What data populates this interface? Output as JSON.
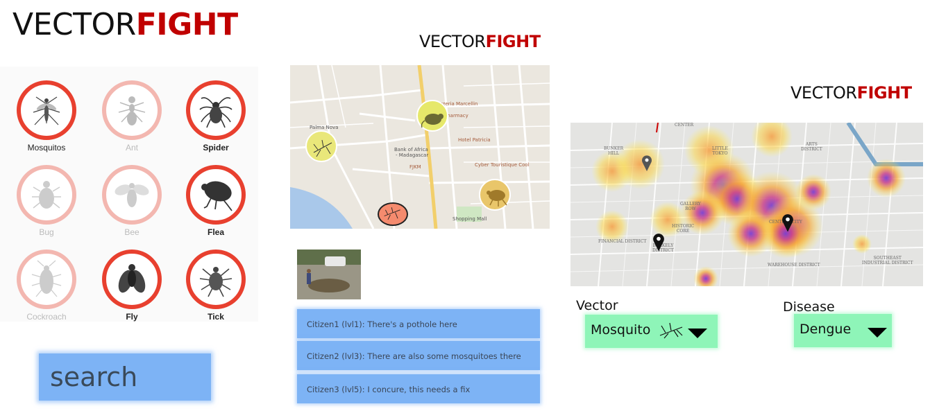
{
  "brand": {
    "part1": "VECTOR",
    "part2": "FIGHT"
  },
  "insects": [
    {
      "label": "Mosquitos",
      "icon": "mosquito-icon",
      "state": "active"
    },
    {
      "label": "Ant",
      "icon": "ant-icon",
      "state": "faded"
    },
    {
      "label": "Spider",
      "icon": "spider-icon",
      "state": "active"
    },
    {
      "label": "Bug",
      "icon": "bug-icon",
      "state": "faded"
    },
    {
      "label": "Bee",
      "icon": "bee-icon",
      "state": "faded"
    },
    {
      "label": "Flea",
      "icon": "flea-icon",
      "state": "active"
    },
    {
      "label": "Cockroach",
      "icon": "cockroach-icon",
      "state": "faded"
    },
    {
      "label": "Fly",
      "icon": "fly-icon",
      "state": "active"
    },
    {
      "label": "Tick",
      "icon": "tick-icon",
      "state": "active"
    }
  ],
  "search": {
    "text": "search"
  },
  "map_places": {
    "palma": "Palma Nova",
    "marcellin": "Pizzeria Marcellin",
    "pharmacy": "Pharmacy",
    "bank": "Bank of Africa",
    "bank2": "- Madagascar",
    "fjkm": "FJKM",
    "hotel": "Hotel Patricia",
    "cyber": "Cyber Touristique Cool",
    "mall": "Shopping Mall"
  },
  "comments": [
    "Citizen1 (lvl1): There's a pothole here",
    "Citizen2 (lvl3): There are also some mosquitoes there",
    "Citizen3 (lvl5): I concure, this needs a fix"
  ],
  "heatmap_places": {
    "bunker": "BUNKER\nHILL",
    "tokyo": "LITTLE\nTOKYO",
    "arts": "ARTS\nDISTRICT",
    "gallery": "GALLERY\nROW",
    "historic": "HISTORIC\nCORE",
    "central": "CENTRAL CITY",
    "financial": "FINANCIAL DISTRICT",
    "berkely": "BERKELY\nDISTRICT",
    "warehouse": "WAREHOUSE DISTRICT",
    "southeast": "SOUTHEAST\nINDUSTRIAL DISTRICT",
    "center": "CENTER"
  },
  "filters": {
    "vector_label": "Vector",
    "vector_value": "Mosquito",
    "disease_label": "Disease",
    "disease_value": "Dengue"
  },
  "colors": {
    "accent_red": "#c00000",
    "circle_red": "#e8402f",
    "button_blue": "#7db3f5",
    "dropdown_green": "#8ef5b8"
  }
}
